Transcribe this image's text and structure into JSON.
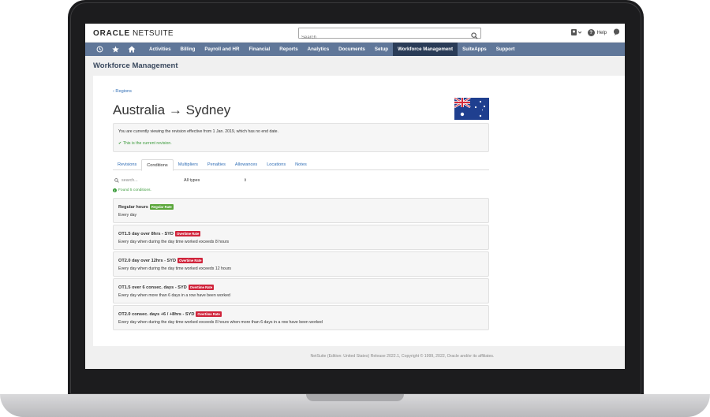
{
  "header": {
    "logo_oracle": "ORACLE",
    "logo_netsuite": "NETSUITE",
    "search_placeholder": "Search",
    "help_label": "Help"
  },
  "nav": {
    "items": [
      {
        "label": "Activities"
      },
      {
        "label": "Billing"
      },
      {
        "label": "Payroll and HR"
      },
      {
        "label": "Financial"
      },
      {
        "label": "Reports"
      },
      {
        "label": "Analytics"
      },
      {
        "label": "Documents"
      },
      {
        "label": "Setup"
      },
      {
        "label": "Workforce Management",
        "active": true
      },
      {
        "label": "SuiteApps"
      },
      {
        "label": "Support"
      }
    ]
  },
  "page": {
    "title": "Workforce Management",
    "back_link": "Regions",
    "region_title": "Australia → Sydney",
    "flag": "australia-flag-icon"
  },
  "revision": {
    "notice": "You are currently viewing the revision effective from 1 Jan. 2019, which has no end date.",
    "current": "This is the current revision."
  },
  "tabs": [
    {
      "label": "Revisions"
    },
    {
      "label": "Conditions",
      "active": true
    },
    {
      "label": "Multipliers"
    },
    {
      "label": "Penalties"
    },
    {
      "label": "Allowances"
    },
    {
      "label": "Locations"
    },
    {
      "label": "Notes"
    }
  ],
  "filter": {
    "search_placeholder": "search...",
    "type_select": "All types",
    "found": "Found 5 conditions."
  },
  "conditions": [
    {
      "name": "Regular hours",
      "badge": "Regular Rate",
      "badge_kind": "regular",
      "desc": "Every day"
    },
    {
      "name": "OT1.5 day over 8hrs - SYD",
      "badge": "Overtime Rate",
      "badge_kind": "overtime",
      "desc": "Every day when during the day time worked exceeds 8 hours"
    },
    {
      "name": "OT2.0 day over 12hrs - SYD",
      "badge": "Overtime Rate",
      "badge_kind": "overtime",
      "desc": "Every day when during the day time worked exceeds 12 hours"
    },
    {
      "name": "OT1.5 over 6 consec. days - SYD",
      "badge": "Overtime Rate",
      "badge_kind": "overtime",
      "desc": "Every day when more than 6 days in a row have been worked"
    },
    {
      "name": "OT2.0 consec. days +6 / +8hrs - SYD",
      "badge": "Overtime Rate",
      "badge_kind": "overtime",
      "desc": "Every day when during the day time worked exceeds 8 hours when more than 6 days in a row have been worked"
    }
  ],
  "footer": {
    "text": "NetSuite (Edition: United States) Release 2022.1, Copyright © 1999, 2022, Oracle and/or its affiliates."
  },
  "colors": {
    "nav_bg": "#607799",
    "nav_active": "#2a3c57",
    "link": "#2f6db5",
    "success": "#3a9a3a",
    "regular_badge": "#5aa63a",
    "overtime_badge": "#d0243b"
  }
}
